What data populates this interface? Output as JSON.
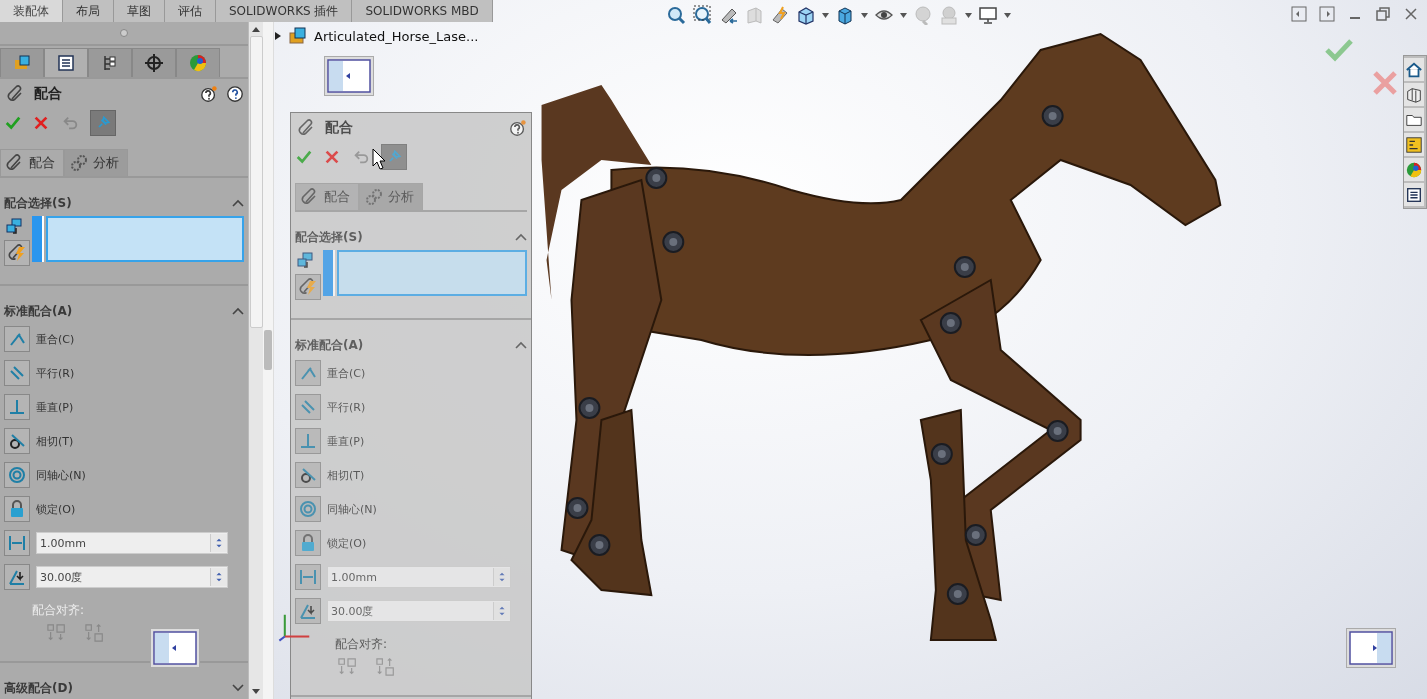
{
  "command_tabs": [
    {
      "label": "装配体",
      "selected": true
    },
    {
      "label": "布局",
      "selected": false
    },
    {
      "label": "草图",
      "selected": false
    },
    {
      "label": "评估",
      "selected": false
    },
    {
      "label": "SOLIDWORKS 插件",
      "selected": false
    },
    {
      "label": "SOLIDWORKS MBD",
      "selected": false
    }
  ],
  "panel_tabs": [
    {
      "kind": "feature-tree",
      "selected": false
    },
    {
      "kind": "property",
      "selected": true
    },
    {
      "kind": "configuration",
      "selected": false
    },
    {
      "kind": "dimxpert",
      "selected": false
    },
    {
      "kind": "display",
      "selected": false
    }
  ],
  "property_manager": {
    "title": "配合",
    "subtabs": [
      {
        "label": "配合",
        "selected": true
      },
      {
        "label": "分析",
        "selected": false
      }
    ],
    "selection_title": "配合选择(S)",
    "standard_title": "标准配合(A)",
    "items": [
      {
        "kind": "coincident",
        "label": "重合(C)"
      },
      {
        "kind": "parallel",
        "label": "平行(R)"
      },
      {
        "kind": "perpendicular",
        "label": "垂直(P)"
      },
      {
        "kind": "tangent",
        "label": "相切(T)"
      },
      {
        "kind": "concentric",
        "label": "同轴心(N)"
      },
      {
        "kind": "lock",
        "label": "锁定(O)"
      },
      {
        "kind": "distance",
        "value": "1.00mm"
      },
      {
        "kind": "angle",
        "value": "30.00度"
      }
    ],
    "alignment_label": "配合对齐:",
    "advanced": {
      "title": "高级配合(D)",
      "expanded": false
    }
  },
  "feature_tree": {
    "root": {
      "label": "Articulated_Horse_Lase...",
      "expanded": false
    }
  },
  "floating_panel": {
    "title": "配合",
    "subtabs": [
      {
        "label": "配合",
        "selected": true
      },
      {
        "label": "分析",
        "selected": false
      }
    ],
    "selection_title": "配合选择(S)",
    "standard_title": "标准配合(A)",
    "items": [
      {
        "kind": "coincident",
        "label": "重合(C)"
      },
      {
        "kind": "parallel",
        "label": "平行(R)"
      },
      {
        "kind": "perpendicular",
        "label": "垂直(P)"
      },
      {
        "kind": "tangent",
        "label": "相切(T)"
      },
      {
        "kind": "concentric",
        "label": "同轴心(N)"
      },
      {
        "kind": "lock",
        "label": "锁定(O)"
      },
      {
        "kind": "distance",
        "value": "1.00mm"
      },
      {
        "kind": "angle",
        "value": "30.00度"
      }
    ],
    "alignment_label": "配合对齐:"
  }
}
